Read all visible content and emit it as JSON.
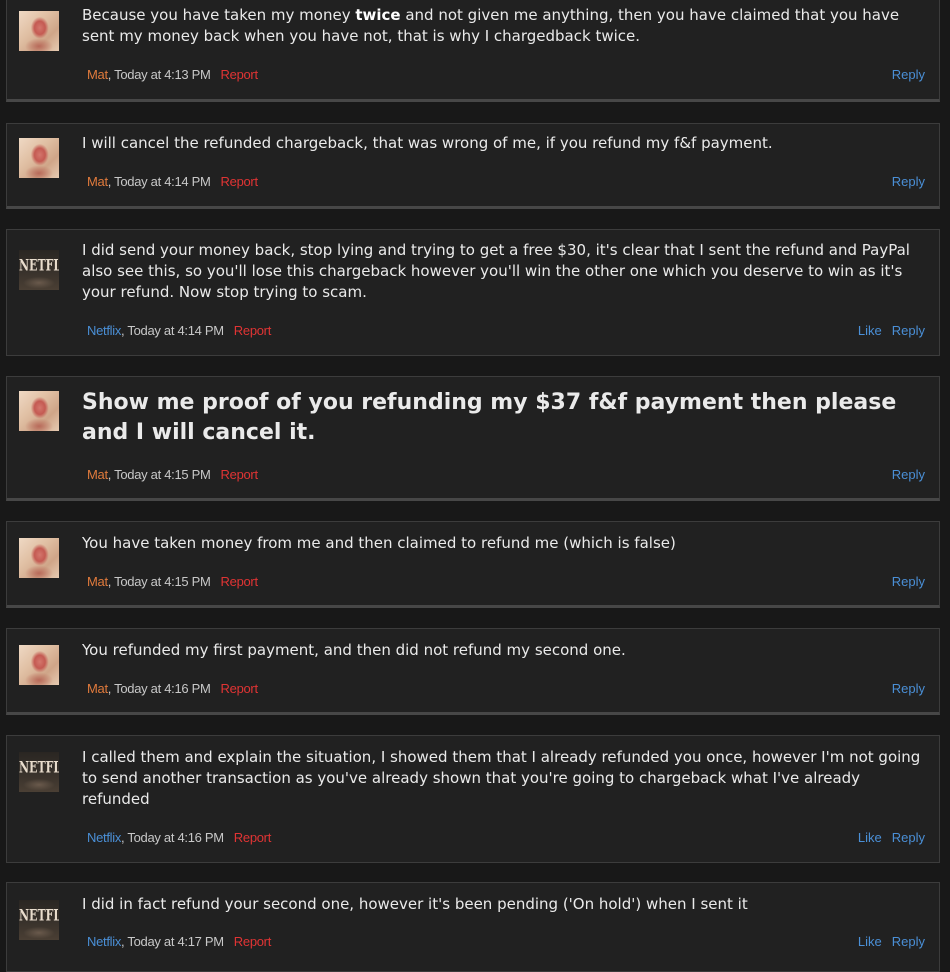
{
  "labels": {
    "reply": "Reply",
    "like": "Like",
    "report": "Report"
  },
  "avatar_text": {
    "netflix": "NETFLIX"
  },
  "messages": [
    {
      "author": "Mat",
      "time": ", Today at 4:13 PM",
      "text_before": "Because you have taken my money ",
      "text_bold": "twice",
      "text_after": " and not given me anything, then you have claimed that you have sent my money back when you have not, that is why I chargedback twice."
    },
    {
      "author": "Mat",
      "time": ", Today at 4:14 PM",
      "text": "I will cancel the refunded chargeback, that was wrong of me, if you refund my f&f payment."
    },
    {
      "author": "Netflix",
      "time": ", Today at 4:14 PM",
      "text": "I did send your money back, stop lying and trying to get a free $30, it's clear that I sent the refund and PayPal also see this, so you'll lose this chargeback however you'll win the other one which you deserve to win as it's your refund. Now stop trying to scam."
    },
    {
      "author": "Mat",
      "time": ", Today at 4:15 PM",
      "text": "Show me proof of you refunding my $37 f&f payment then please and I will cancel it."
    },
    {
      "author": "Mat",
      "time": ", Today at 4:15 PM",
      "text": "You have taken money from me and then claimed to refund me (which is false)"
    },
    {
      "author": "Mat",
      "time": ", Today at 4:16 PM",
      "text": "You refunded my first payment, and then did not refund my second one."
    },
    {
      "author": "Netflix",
      "time": ", Today at 4:16 PM",
      "text": "I called them and explain the situation, I showed them that I already refunded you once, however I'm not going to send another transaction as you've already shown that you're going to chargeback what I've already refunded"
    },
    {
      "author": "Netflix",
      "time": ", Today at 4:17 PM",
      "text": "I did in fact refund your second one, however it's been pending ('On hold') when I sent it"
    }
  ]
}
